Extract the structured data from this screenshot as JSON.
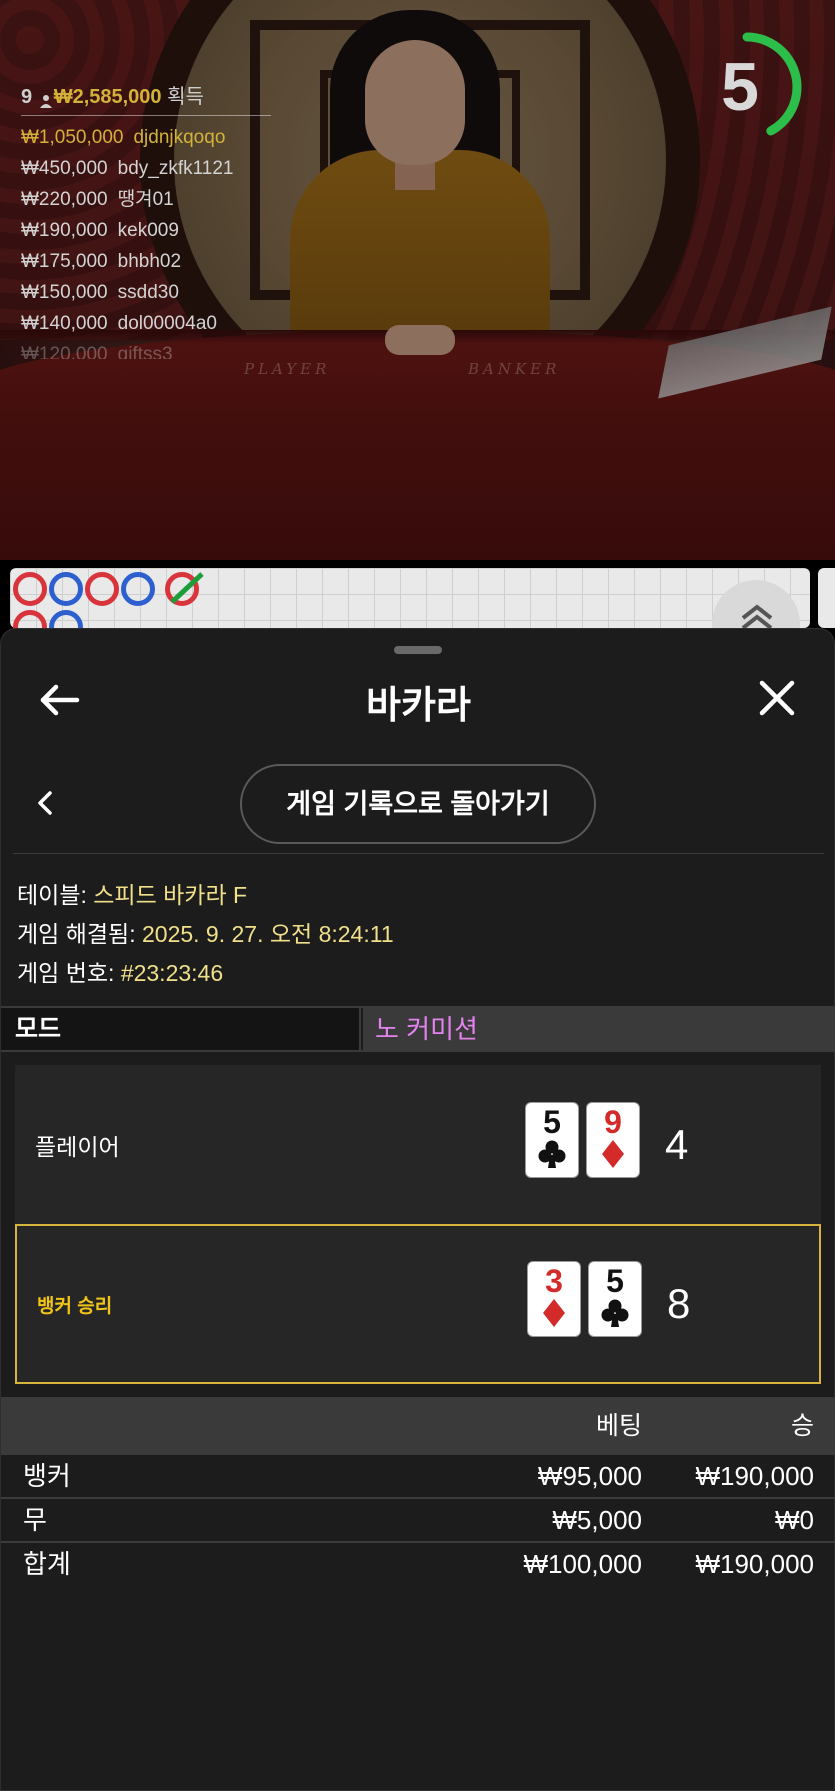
{
  "timer": {
    "value": "5",
    "progress": 0.42,
    "color": "#2dbd4a"
  },
  "winners": {
    "count": "9",
    "total": "₩2,585,000",
    "suffix": "획득",
    "rows": [
      {
        "amount": "₩1,050,000",
        "name": "djdnjkqoqo"
      },
      {
        "amount": "₩450,000",
        "name": "bdy_zkfk1121"
      },
      {
        "amount": "₩220,000",
        "name": "땡겨01"
      },
      {
        "amount": "₩190,000",
        "name": "kek009"
      },
      {
        "amount": "₩175,000",
        "name": "bhbh02"
      },
      {
        "amount": "₩150,000",
        "name": "ssdd30"
      },
      {
        "amount": "₩140,000",
        "name": "dol00004a0"
      },
      {
        "amount": "₩120,000",
        "name": "giftss3"
      }
    ]
  },
  "table_labels": {
    "player": "PLAYER",
    "banker": "BANKER"
  },
  "sheet": {
    "title": "바카라",
    "history_button": "게임 기록으로 돌아가기",
    "meta": {
      "table_label": "테이블: ",
      "table_value": "스피드 바카라 F",
      "resolved_label": "게임 해결됨: ",
      "resolved_value": "2025. 9. 27. 오전 8:24:11",
      "round_label": "게임 번호: ",
      "round_value": "#23:23:46"
    },
    "mode": {
      "label": "모드",
      "value": "노 커미션"
    },
    "hands": {
      "player": {
        "label": "플레이어",
        "score": "4",
        "cards": [
          {
            "rank": "5",
            "suit": "club"
          },
          {
            "rank": "9",
            "suit": "diamond"
          }
        ]
      },
      "banker": {
        "label": "뱅커 승리",
        "score": "8",
        "cards": [
          {
            "rank": "3",
            "suit": "diamond"
          },
          {
            "rank": "5",
            "suit": "club"
          }
        ]
      }
    },
    "bets": {
      "headers": {
        "bet": "베팅",
        "win": "승"
      },
      "rows": [
        {
          "name": "뱅커",
          "bet": "₩95,000",
          "win": "₩190,000"
        },
        {
          "name": "무",
          "bet": "₩5,000",
          "win": "₩0"
        }
      ],
      "total": {
        "name": "합계",
        "bet": "₩100,000",
        "win": "₩190,000"
      }
    }
  },
  "colors": {
    "accent_gold": "#d4b23a",
    "banker_highlight": "#d9b43c",
    "mode_value": "#e483f0",
    "meta_value": "#f0e08a"
  }
}
